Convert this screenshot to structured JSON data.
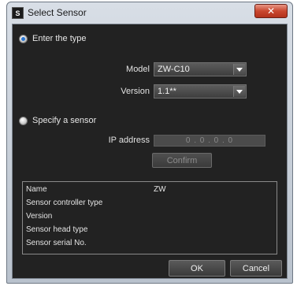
{
  "window": {
    "title": "Select Sensor",
    "app_icon_glyph": "S",
    "close_glyph": "✕"
  },
  "mode": {
    "enter_type_label": "Enter the type",
    "specify_sensor_label": "Specify a sensor",
    "selected": "enter_type"
  },
  "type": {
    "model_label": "Model",
    "model_value": "ZW-C10",
    "version_label": "Version",
    "version_value": "1.1**"
  },
  "sensor": {
    "ip_label": "IP address",
    "ip_value": "0 . 0 . 0 . 0",
    "confirm_label": "Confirm"
  },
  "info": {
    "rows": [
      {
        "label": "Name",
        "value": "ZW"
      },
      {
        "label": "Sensor controller type",
        "value": ""
      },
      {
        "label": "Version",
        "value": ""
      },
      {
        "label": "Sensor head type",
        "value": ""
      },
      {
        "label": "Sensor serial No.",
        "value": ""
      }
    ]
  },
  "buttons": {
    "ok": "OK",
    "cancel": "Cancel"
  },
  "colors": {
    "client_bg": "#222222",
    "radio_selected": "#2a76d2",
    "close_button": "#c9472f"
  }
}
